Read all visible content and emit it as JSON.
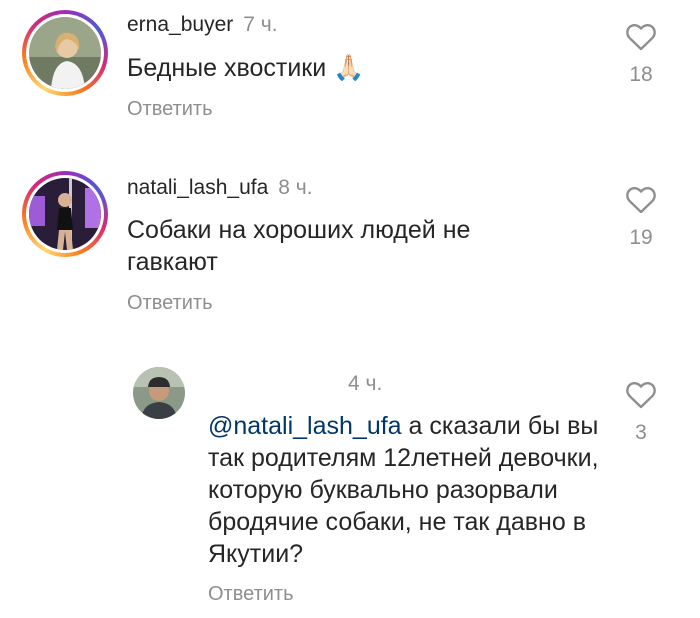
{
  "comments": [
    {
      "username": "erna_buyer",
      "time": "7 ч.",
      "text": "Бедные хвостики",
      "emoji": "🙏🏻",
      "reply_label": "Ответить",
      "likes": "18",
      "avatar_story_ring": true
    },
    {
      "username": "natali_lash_ufa",
      "time": "8 ч.",
      "text": "Собаки на хороших людей не гавкают",
      "reply_label": "Ответить",
      "likes": "19",
      "avatar_story_ring": true
    }
  ],
  "reply": {
    "username": "",
    "time": "4 ч.",
    "mention": "@natali_lash_ufa",
    "text": " а сказали бы вы так родителям 12летней девочки, которую буквально разорвали бродячие собаки, не так давно в Якутии?",
    "reply_label": "Ответить",
    "likes": "3",
    "avatar_story_ring": false
  },
  "icons": {
    "like": "heart-outline-icon"
  },
  "colors": {
    "mention": "#00376b",
    "secondary_text": "#8e8e8e",
    "primary_text": "#262626"
  }
}
